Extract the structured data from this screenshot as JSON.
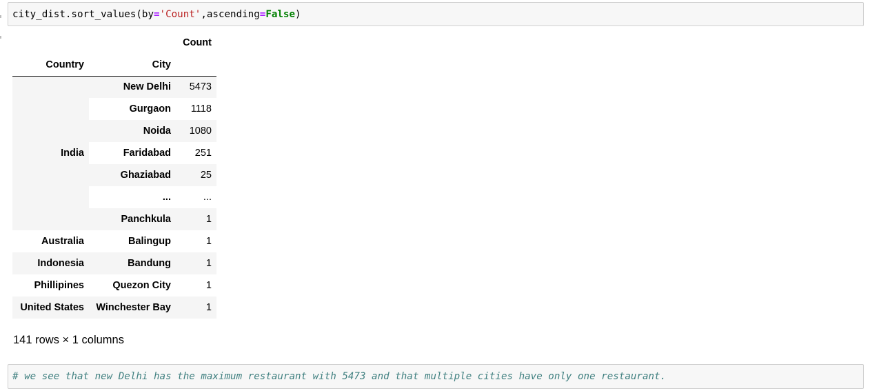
{
  "code_cell": {
    "prefix": "city_dist.sort_values(by",
    "eq1": "=",
    "arg_value": "'Count'",
    "mid": ",ascending",
    "eq2": "=",
    "bool_value": "False",
    "suffix": ")"
  },
  "table": {
    "column_header": "Count",
    "index_headers": [
      "Country",
      "City"
    ],
    "rows": [
      {
        "country": "",
        "city": "New Delhi",
        "count": "5473"
      },
      {
        "country": "",
        "city": "Gurgaon",
        "count": "1118"
      },
      {
        "country": "",
        "city": "Noida",
        "count": "1080"
      },
      {
        "country": "India",
        "city": "Faridabad",
        "count": "251"
      },
      {
        "country": "",
        "city": "Ghaziabad",
        "count": "25"
      },
      {
        "country": "",
        "city": "...",
        "count": "..."
      },
      {
        "country": "",
        "city": "Panchkula",
        "count": "1"
      },
      {
        "country": "Australia",
        "city": "Balingup",
        "count": "1"
      },
      {
        "country": "Indonesia",
        "city": "Bandung",
        "count": "1"
      },
      {
        "country": "Phillipines",
        "city": "Quezon City",
        "count": "1"
      },
      {
        "country": "United States",
        "city": "Winchester Bay",
        "count": "1"
      }
    ]
  },
  "shape_text": "141 rows × 1 columns",
  "comment_cell": {
    "text": "# we see that new Delhi has the maximum restaurant with 5473 and that multiple cities have only one restaurant."
  }
}
